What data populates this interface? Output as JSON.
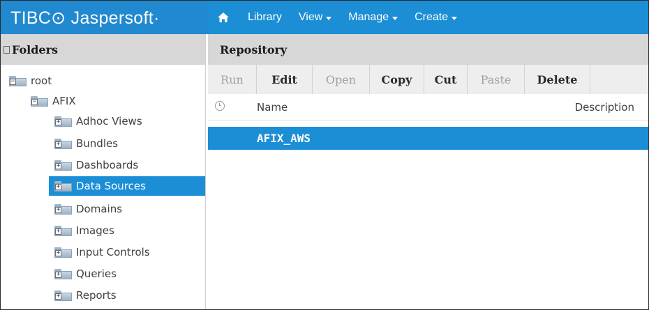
{
  "app": {
    "brand": "TIBC⊙ Jaspersoft·"
  },
  "nav": {
    "library": "Library",
    "view": "View",
    "manage": "Manage",
    "create": "Create"
  },
  "folders": {
    "title": "Folders",
    "tree": [
      {
        "label": "root"
      },
      {
        "label": "AFIX"
      },
      {
        "label": "Adhoc Views"
      },
      {
        "label": "Bundles"
      },
      {
        "label": "Dashboards"
      },
      {
        "label": "Data Sources"
      },
      {
        "label": "Domains"
      },
      {
        "label": "Images"
      },
      {
        "label": "Input Controls"
      },
      {
        "label": "Queries"
      },
      {
        "label": "Reports"
      }
    ]
  },
  "repository": {
    "title": "Repository",
    "toolbar": {
      "run": "Run",
      "edit": "Edit",
      "open": "Open",
      "copy": "Copy",
      "cut": "Cut",
      "paste": "Paste",
      "delete": "Delete"
    },
    "columns": {
      "name": "Name",
      "description": "Description"
    },
    "rows": [
      {
        "name": "AFIX_AWS"
      }
    ]
  },
  "colors": {
    "accent": "#1b8ed6",
    "header_gray": "#d7d7d7"
  }
}
